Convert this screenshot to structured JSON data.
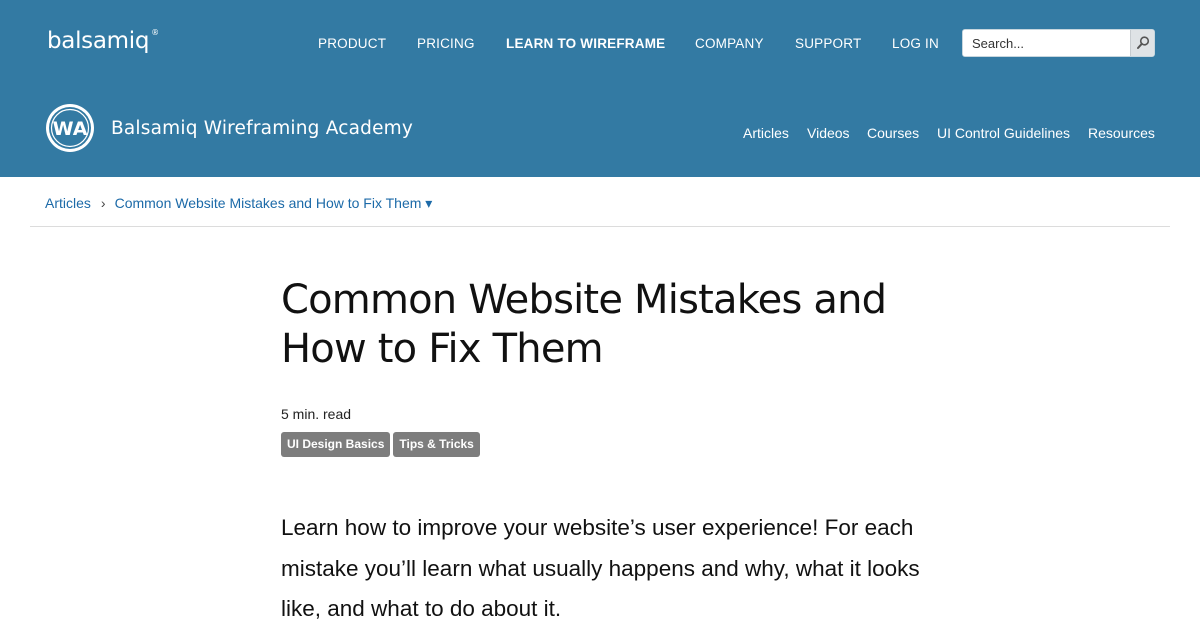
{
  "brand": {
    "name": "balsamiq",
    "registered": "®"
  },
  "top_nav": [
    {
      "label": "PRODUCT",
      "active": false
    },
    {
      "label": "PRICING",
      "active": false
    },
    {
      "label": "LEARN TO WIREFRAME",
      "active": true
    },
    {
      "label": "COMPANY",
      "active": false
    },
    {
      "label": "SUPPORT",
      "active": false
    },
    {
      "label": "LOG IN",
      "active": false
    }
  ],
  "search": {
    "placeholder": "Search...",
    "value": ""
  },
  "academy": {
    "badge_text": "WA",
    "title": "Balsamiq Wireframing Academy"
  },
  "sub_nav": [
    "Articles",
    "Videos",
    "Courses",
    "UI Control Guidelines",
    "Resources"
  ],
  "breadcrumb": {
    "root": "Articles",
    "separator": "›",
    "current": "Common Website Mistakes and How to Fix Them ▾"
  },
  "article": {
    "title": "Common Website Mistakes and How to Fix Them",
    "read_time": "5 min. read",
    "tags": [
      "UI Design Basics",
      "Tips & Tricks"
    ],
    "intro": "Learn how to improve your website’s user experience! For each mistake you’ll learn what usually happens and why, what it looks like, and what to do about it."
  },
  "colors": {
    "header_bg": "#337aa3",
    "link": "#1c6aa8",
    "tag_bg": "#7d7d7d"
  }
}
